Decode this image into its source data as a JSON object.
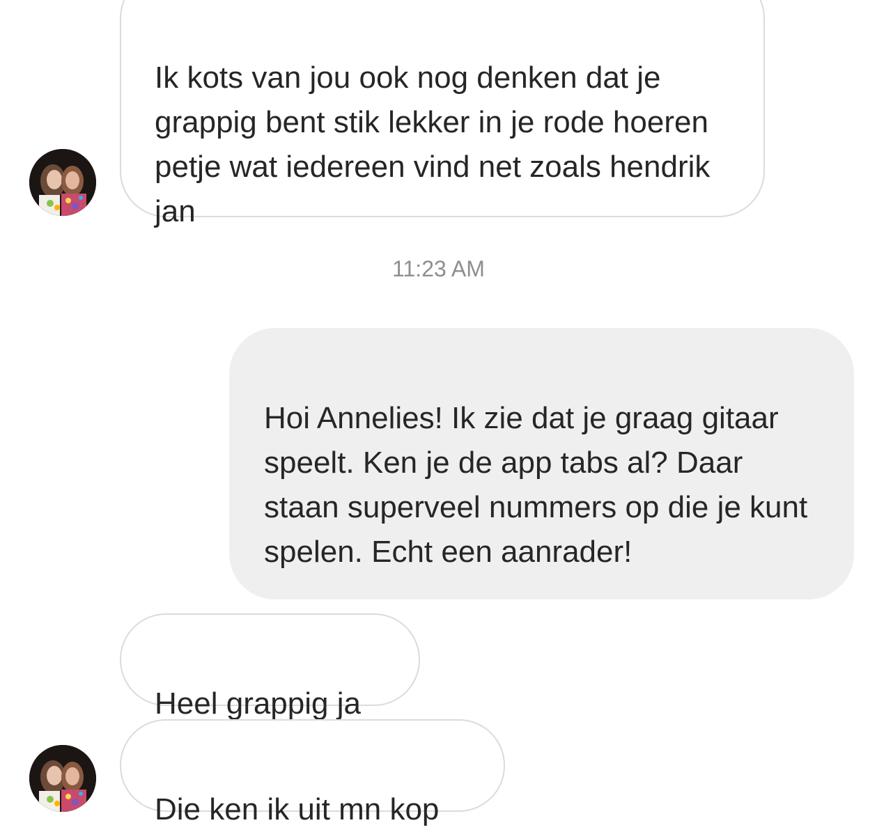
{
  "thread": {
    "messages": [
      {
        "direction": "incoming",
        "text": "Ik kots van jou ook nog denken dat je grappig bent stik lekker in je rode hoeren petje wat iedereen vind net zoals hendrik jan"
      },
      {
        "direction": "outgoing",
        "text": "Hoi Annelies! Ik zie dat je graag gitaar speelt. Ken je de app tabs al? Daar staan superveel nummers op die je kunt spelen. Echt een aanrader!"
      },
      {
        "direction": "incoming",
        "text": "Heel grappig ja"
      },
      {
        "direction": "incoming",
        "text": "Die ken ik uit mn kop"
      }
    ],
    "timestamp": "11:23 AM"
  },
  "icons": {
    "avatar": "profile-photo-avatar"
  },
  "colors": {
    "incoming_bubble_border": "#dbdbdb",
    "outgoing_bubble_bg": "#efefef",
    "text": "#262626",
    "timestamp": "#8e8e8e"
  }
}
